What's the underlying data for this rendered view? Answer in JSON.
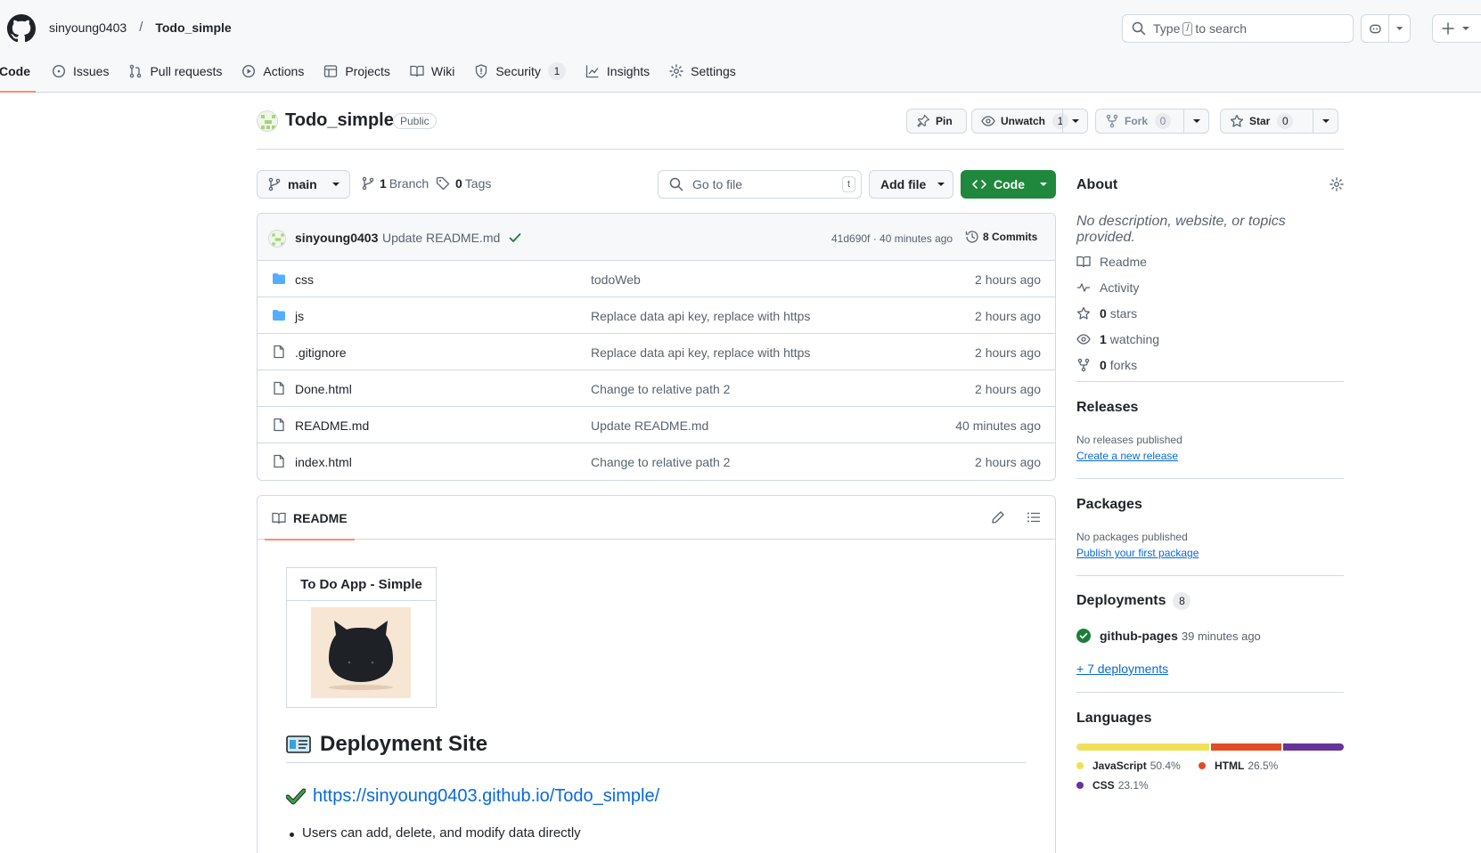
{
  "header": {
    "owner": "sinyoung0403",
    "separator": "/",
    "repo": "Todo_simple",
    "search_prefix": "Type",
    "search_key": "/",
    "search_suffix": "to search"
  },
  "nav": {
    "code": "Code",
    "issues": "Issues",
    "pulls": "Pull requests",
    "actions": "Actions",
    "projects": "Projects",
    "wiki": "Wiki",
    "security": "Security",
    "security_count": "1",
    "insights": "Insights",
    "settings": "Settings"
  },
  "repo": {
    "name": "Todo_simple",
    "visibility": "Public",
    "pin": "Pin",
    "unwatch": "Unwatch",
    "watch_count": "1",
    "fork": "Fork",
    "fork_count": "0",
    "star": "Star",
    "star_count": "0"
  },
  "browser": {
    "branch": "main",
    "branches_count": "1",
    "branches_label": "Branch",
    "tags_count": "0",
    "tags_label": "Tags",
    "go_to_file": "Go to file",
    "go_to_file_key": "t",
    "add_file": "Add file",
    "code": "Code"
  },
  "commit": {
    "author": "sinyoung0403",
    "message": "Update README.md",
    "sha_time": "41d690f · 40 minutes ago",
    "commits": "8 Commits"
  },
  "files": [
    {
      "name": "css",
      "type": "folder",
      "message": "todoWeb",
      "time": "2 hours ago"
    },
    {
      "name": "js",
      "type": "folder",
      "message": "Replace data api key, replace with https",
      "time": "2 hours ago"
    },
    {
      "name": ".gitignore",
      "type": "file",
      "message": "Replace data api key, replace with https",
      "time": "2 hours ago"
    },
    {
      "name": "Done.html",
      "type": "file",
      "message": "Change to relative path 2",
      "time": "2 hours ago"
    },
    {
      "name": "README.md",
      "type": "file",
      "message": "Update README.md",
      "time": "40 minutes ago"
    },
    {
      "name": "index.html",
      "type": "file",
      "message": "Change to relative path 2",
      "time": "2 hours ago"
    }
  ],
  "readme": {
    "tab": "README",
    "table_header": "To Do App - Simple",
    "heading": "Deployment Site",
    "link": "https://sinyoung0403.github.io/Todo_simple/",
    "bullet": "Users can add, delete, and modify data directly"
  },
  "about": {
    "title": "About",
    "description": "No description, website, or topics provided.",
    "readme": "Readme",
    "activity": "Activity",
    "stars_count": "0",
    "stars_label": "stars",
    "watching_count": "1",
    "watching_label": "watching",
    "forks_count": "0",
    "forks_label": "forks"
  },
  "releases": {
    "title": "Releases",
    "empty": "No releases published",
    "create": "Create a new release"
  },
  "packages": {
    "title": "Packages",
    "empty": "No packages published",
    "publish": "Publish your first package"
  },
  "deployments": {
    "title": "Deployments",
    "count": "8",
    "env": "github-pages",
    "time": "39 minutes ago",
    "more": "+ 7 deployments"
  },
  "languages": {
    "title": "Languages",
    "items": [
      {
        "name": "JavaScript",
        "percent": "50.4%",
        "value": 50.4,
        "color": "#f1e05a"
      },
      {
        "name": "HTML",
        "percent": "26.5%",
        "value": 26.5,
        "color": "#e34c26"
      },
      {
        "name": "CSS",
        "percent": "23.1%",
        "value": 23.1,
        "color": "#663399"
      }
    ]
  },
  "colors": {
    "accent": "#0969da",
    "green": "#1f883d",
    "nav_underline": "#fd8c73",
    "folder": "#54aeff"
  },
  "icons": [
    "github-logo-icon",
    "search-icon",
    "copilot-icon",
    "plus-icon",
    "code-icon",
    "issue-icon",
    "pull-request-icon",
    "play-icon",
    "table-icon",
    "book-icon",
    "shield-icon",
    "graph-icon",
    "gear-icon",
    "pin-icon",
    "eye-icon",
    "fork-icon",
    "star-icon",
    "branch-icon",
    "tag-icon",
    "history-icon",
    "folder-icon",
    "file-icon",
    "pencil-icon",
    "list-icon",
    "pulse-icon",
    "check-circle-icon"
  ]
}
